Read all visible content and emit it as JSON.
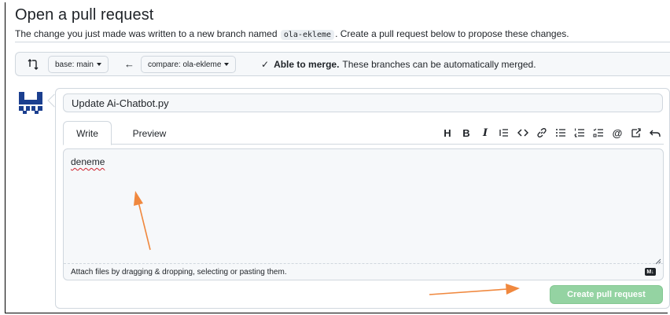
{
  "page": {
    "title": "Open a pull request",
    "subtitle_before": "The change you just made was written to a new branch named",
    "branch_chip": "ola-ekleme",
    "subtitle_after": ". Create a pull request below to propose these changes."
  },
  "compare_bar": {
    "base_label": "base: main",
    "compare_label": "compare: ola-ekleme",
    "arrow": "←",
    "merge_title": "Able to merge.",
    "merge_detail": "These branches can be automatically merged."
  },
  "form": {
    "title_value": "Update Ai-Chatbot.py",
    "tabs": [
      {
        "label": "Write",
        "active": true
      },
      {
        "label": "Preview",
        "active": false
      }
    ],
    "toolbar": {
      "heading": "H",
      "bold": "B",
      "italic": "I",
      "mention": "@",
      "icons": [
        "heading-icon",
        "bold-icon",
        "italic-icon",
        "quote-icon",
        "code-icon",
        "link-icon",
        "unordered-list-icon",
        "ordered-list-icon",
        "task-list-icon",
        "mention-icon",
        "cross-reference-icon",
        "undo-icon"
      ]
    },
    "body_text": "deneme",
    "attach_hint": "Attach files by dragging & dropping, selecting or pasting them.",
    "markdown_badge": "M↓",
    "submit_label": "Create pull request"
  },
  "colors": {
    "accent_green": "#94d3a2",
    "annotation_orange": "#f0883e",
    "border": "#d0d7de"
  }
}
